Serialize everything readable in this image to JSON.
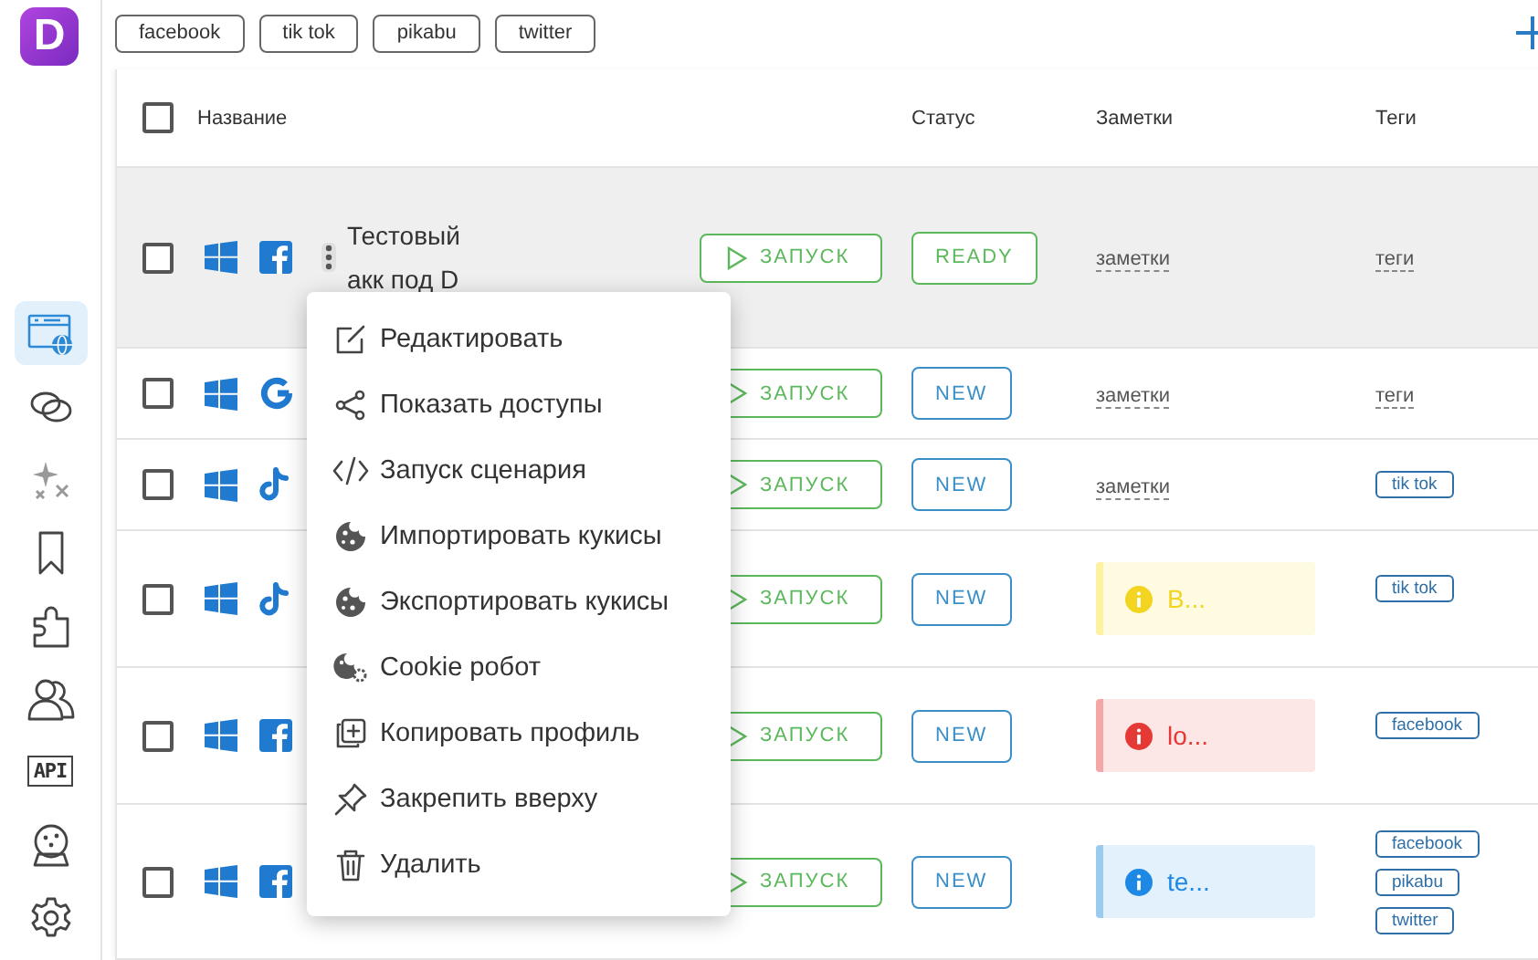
{
  "app": {
    "logo": "D"
  },
  "sidebar": {
    "items": [
      {
        "kind": "browser",
        "selected": true
      },
      {
        "kind": "link",
        "selected": false
      },
      {
        "kind": "sparkles",
        "selected": false
      },
      {
        "kind": "bookmark",
        "selected": false
      },
      {
        "kind": "puzzle",
        "selected": false
      },
      {
        "kind": "users",
        "selected": false
      },
      {
        "kind": "api",
        "label": "API",
        "selected": false
      },
      {
        "kind": "crystal-ball",
        "selected": false
      },
      {
        "kind": "settings",
        "selected": false
      }
    ]
  },
  "tag_filters": [
    {
      "label": "facebook"
    },
    {
      "label": "tik tok"
    },
    {
      "label": "pikabu"
    },
    {
      "label": "twitter"
    }
  ],
  "table": {
    "header_checked": false,
    "columns": [
      "Название",
      "Статус",
      "Заметки",
      "Теги"
    ],
    "rows": [
      {
        "checked": false,
        "highlighted": true,
        "icons": [
          {
            "kind": "windows"
          },
          {
            "kind": "facebook"
          }
        ],
        "name": "Тестовый акк под D",
        "launch": "ЗАПУСК",
        "status": {
          "text": "READY",
          "color": "#5cb85c"
        },
        "note": {
          "kind": "placeholder",
          "text": "заметки"
        },
        "tags_hint": "теги"
      },
      {
        "checked": false,
        "highlighted": false,
        "icons": [
          {
            "kind": "windows"
          },
          {
            "kind": "google"
          }
        ],
        "launch": "ЗАПУСК",
        "status": {
          "text": "NEW",
          "color": "#3a8fc7"
        },
        "note": {
          "kind": "placeholder",
          "text": "заметки"
        },
        "tags_hint": "теги"
      },
      {
        "checked": false,
        "highlighted": false,
        "icons": [
          {
            "kind": "windows"
          },
          {
            "kind": "tiktok"
          }
        ],
        "launch": "ЗАПУСК",
        "status": {
          "text": "NEW",
          "color": "#3a8fc7"
        },
        "note": {
          "kind": "placeholder",
          "text": "заметки"
        },
        "tags": [
          "tik tok"
        ]
      },
      {
        "checked": false,
        "highlighted": false,
        "icons": [
          {
            "kind": "windows"
          },
          {
            "kind": "tiktok"
          }
        ],
        "launch": "ЗАПУСК",
        "status": {
          "text": "NEW",
          "color": "#3a8fc7"
        },
        "note": {
          "kind": "warning",
          "text": "В..."
        },
        "tags": [
          "tik tok"
        ]
      },
      {
        "checked": false,
        "highlighted": false,
        "icons": [
          {
            "kind": "windows"
          },
          {
            "kind": "facebook"
          }
        ],
        "launch": "ЗАПУСК",
        "status": {
          "text": "NEW",
          "color": "#3a8fc7"
        },
        "note": {
          "kind": "error",
          "text": "lo..."
        },
        "tags": [
          "facebook"
        ]
      },
      {
        "checked": false,
        "highlighted": false,
        "icons": [
          {
            "kind": "windows"
          },
          {
            "kind": "facebook"
          }
        ],
        "launch": "ЗАПУСК",
        "status": {
          "text": "NEW",
          "color": "#3a8fc7"
        },
        "note": {
          "kind": "info",
          "text": "te..."
        },
        "tags": [
          "facebook",
          "pikabu",
          "twitter"
        ]
      }
    ]
  },
  "context_menu": {
    "items": [
      {
        "kind": "edit",
        "label": "Редактировать"
      },
      {
        "kind": "share",
        "label": "Показать доступы"
      },
      {
        "kind": "code",
        "label": "Запуск сценария"
      },
      {
        "kind": "cookie",
        "label": "Импортировать кукисы"
      },
      {
        "kind": "cookie",
        "label": "Экспортировать кукисы"
      },
      {
        "kind": "cookie-robot",
        "label": "Cookie робот"
      },
      {
        "kind": "copy",
        "label": "Копировать профиль"
      },
      {
        "kind": "pin",
        "label": "Закрепить вверху"
      },
      {
        "kind": "delete",
        "label": "Удалить"
      }
    ]
  }
}
